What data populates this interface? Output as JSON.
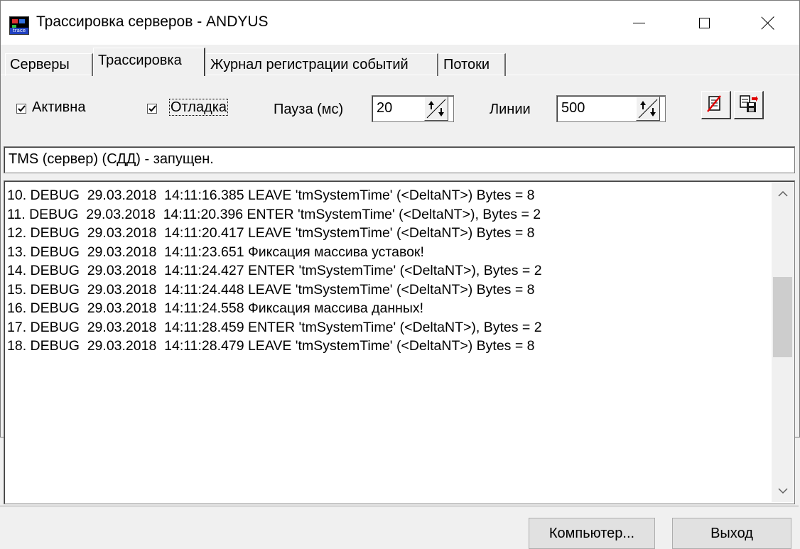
{
  "window": {
    "title": "Трассировка серверов - ANDYUS",
    "icon_label": "trace"
  },
  "tabs": [
    {
      "label": "Серверы"
    },
    {
      "label": "Трассировка"
    },
    {
      "label": "Журнал регистрации событий"
    },
    {
      "label": "Потоки"
    }
  ],
  "active_tab": "Трассировка",
  "toolbar": {
    "active_label": "Активна",
    "active_checked": true,
    "debug_label": "Отладка",
    "debug_checked": true,
    "pause_label": "Пауза (мс)",
    "pause_value": "20",
    "lines_label": "Линии",
    "lines_value": "500"
  },
  "status_text": "TMS (сервер) (СДД)  - запущен.",
  "log": [
    "10. DEBUG  29.03.2018  14:11:16.385 LEAVE 'tmSystemTime' (<DeltaNT>) Bytes = 8",
    "11. DEBUG  29.03.2018  14:11:20.396 ENTER 'tmSystemTime' (<DeltaNT>), Bytes = 2",
    "12. DEBUG  29.03.2018  14:11:20.417 LEAVE 'tmSystemTime' (<DeltaNT>) Bytes = 8",
    "13. DEBUG  29.03.2018  14:11:23.651 Фиксация массива уставок!",
    "14. DEBUG  29.03.2018  14:11:24.427 ENTER 'tmSystemTime' (<DeltaNT>), Bytes = 2",
    "15. DEBUG  29.03.2018  14:11:24.448 LEAVE 'tmSystemTime' (<DeltaNT>) Bytes = 8",
    "16. DEBUG  29.03.2018  14:11:24.558 Фиксация массива данных!",
    "17. DEBUG  29.03.2018  14:11:28.459 ENTER 'tmSystemTime' (<DeltaNT>), Bytes = 2",
    "18. DEBUG  29.03.2018  14:11:28.479 LEAVE 'tmSystemTime' (<DeltaNT>) Bytes = 8"
  ],
  "buttons": {
    "computer_label": "Компьютер...",
    "exit_label": "Выход"
  }
}
